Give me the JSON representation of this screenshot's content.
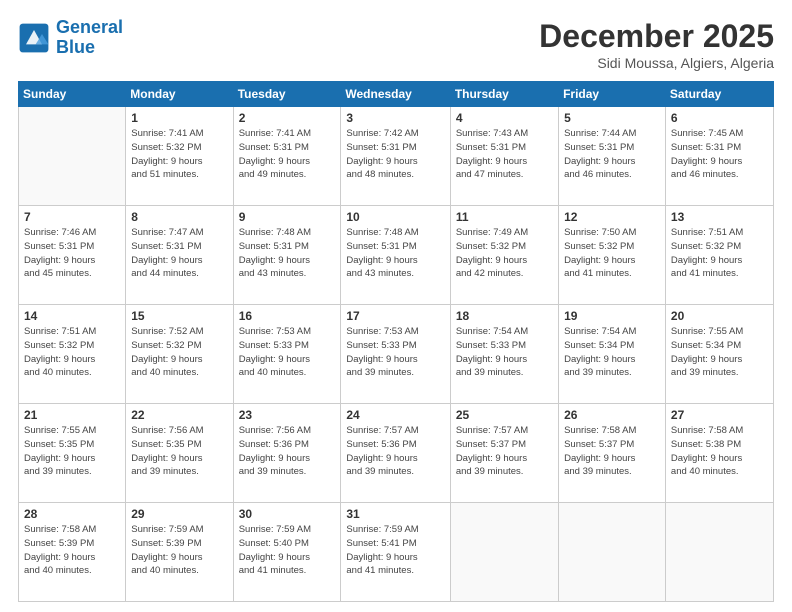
{
  "logo": {
    "line1": "General",
    "line2": "Blue"
  },
  "header": {
    "month": "December 2025",
    "location": "Sidi Moussa, Algiers, Algeria"
  },
  "weekdays": [
    "Sunday",
    "Monday",
    "Tuesday",
    "Wednesday",
    "Thursday",
    "Friday",
    "Saturday"
  ],
  "weeks": [
    [
      {
        "day": "",
        "info": ""
      },
      {
        "day": "1",
        "info": "Sunrise: 7:41 AM\nSunset: 5:32 PM\nDaylight: 9 hours\nand 51 minutes."
      },
      {
        "day": "2",
        "info": "Sunrise: 7:41 AM\nSunset: 5:31 PM\nDaylight: 9 hours\nand 49 minutes."
      },
      {
        "day": "3",
        "info": "Sunrise: 7:42 AM\nSunset: 5:31 PM\nDaylight: 9 hours\nand 48 minutes."
      },
      {
        "day": "4",
        "info": "Sunrise: 7:43 AM\nSunset: 5:31 PM\nDaylight: 9 hours\nand 47 minutes."
      },
      {
        "day": "5",
        "info": "Sunrise: 7:44 AM\nSunset: 5:31 PM\nDaylight: 9 hours\nand 46 minutes."
      },
      {
        "day": "6",
        "info": "Sunrise: 7:45 AM\nSunset: 5:31 PM\nDaylight: 9 hours\nand 46 minutes."
      }
    ],
    [
      {
        "day": "7",
        "info": "Sunrise: 7:46 AM\nSunset: 5:31 PM\nDaylight: 9 hours\nand 45 minutes."
      },
      {
        "day": "8",
        "info": "Sunrise: 7:47 AM\nSunset: 5:31 PM\nDaylight: 9 hours\nand 44 minutes."
      },
      {
        "day": "9",
        "info": "Sunrise: 7:48 AM\nSunset: 5:31 PM\nDaylight: 9 hours\nand 43 minutes."
      },
      {
        "day": "10",
        "info": "Sunrise: 7:48 AM\nSunset: 5:31 PM\nDaylight: 9 hours\nand 43 minutes."
      },
      {
        "day": "11",
        "info": "Sunrise: 7:49 AM\nSunset: 5:32 PM\nDaylight: 9 hours\nand 42 minutes."
      },
      {
        "day": "12",
        "info": "Sunrise: 7:50 AM\nSunset: 5:32 PM\nDaylight: 9 hours\nand 41 minutes."
      },
      {
        "day": "13",
        "info": "Sunrise: 7:51 AM\nSunset: 5:32 PM\nDaylight: 9 hours\nand 41 minutes."
      }
    ],
    [
      {
        "day": "14",
        "info": "Sunrise: 7:51 AM\nSunset: 5:32 PM\nDaylight: 9 hours\nand 40 minutes."
      },
      {
        "day": "15",
        "info": "Sunrise: 7:52 AM\nSunset: 5:32 PM\nDaylight: 9 hours\nand 40 minutes."
      },
      {
        "day": "16",
        "info": "Sunrise: 7:53 AM\nSunset: 5:33 PM\nDaylight: 9 hours\nand 40 minutes."
      },
      {
        "day": "17",
        "info": "Sunrise: 7:53 AM\nSunset: 5:33 PM\nDaylight: 9 hours\nand 39 minutes."
      },
      {
        "day": "18",
        "info": "Sunrise: 7:54 AM\nSunset: 5:33 PM\nDaylight: 9 hours\nand 39 minutes."
      },
      {
        "day": "19",
        "info": "Sunrise: 7:54 AM\nSunset: 5:34 PM\nDaylight: 9 hours\nand 39 minutes."
      },
      {
        "day": "20",
        "info": "Sunrise: 7:55 AM\nSunset: 5:34 PM\nDaylight: 9 hours\nand 39 minutes."
      }
    ],
    [
      {
        "day": "21",
        "info": "Sunrise: 7:55 AM\nSunset: 5:35 PM\nDaylight: 9 hours\nand 39 minutes."
      },
      {
        "day": "22",
        "info": "Sunrise: 7:56 AM\nSunset: 5:35 PM\nDaylight: 9 hours\nand 39 minutes."
      },
      {
        "day": "23",
        "info": "Sunrise: 7:56 AM\nSunset: 5:36 PM\nDaylight: 9 hours\nand 39 minutes."
      },
      {
        "day": "24",
        "info": "Sunrise: 7:57 AM\nSunset: 5:36 PM\nDaylight: 9 hours\nand 39 minutes."
      },
      {
        "day": "25",
        "info": "Sunrise: 7:57 AM\nSunset: 5:37 PM\nDaylight: 9 hours\nand 39 minutes."
      },
      {
        "day": "26",
        "info": "Sunrise: 7:58 AM\nSunset: 5:37 PM\nDaylight: 9 hours\nand 39 minutes."
      },
      {
        "day": "27",
        "info": "Sunrise: 7:58 AM\nSunset: 5:38 PM\nDaylight: 9 hours\nand 40 minutes."
      }
    ],
    [
      {
        "day": "28",
        "info": "Sunrise: 7:58 AM\nSunset: 5:39 PM\nDaylight: 9 hours\nand 40 minutes."
      },
      {
        "day": "29",
        "info": "Sunrise: 7:59 AM\nSunset: 5:39 PM\nDaylight: 9 hours\nand 40 minutes."
      },
      {
        "day": "30",
        "info": "Sunrise: 7:59 AM\nSunset: 5:40 PM\nDaylight: 9 hours\nand 41 minutes."
      },
      {
        "day": "31",
        "info": "Sunrise: 7:59 AM\nSunset: 5:41 PM\nDaylight: 9 hours\nand 41 minutes."
      },
      {
        "day": "",
        "info": ""
      },
      {
        "day": "",
        "info": ""
      },
      {
        "day": "",
        "info": ""
      }
    ]
  ]
}
